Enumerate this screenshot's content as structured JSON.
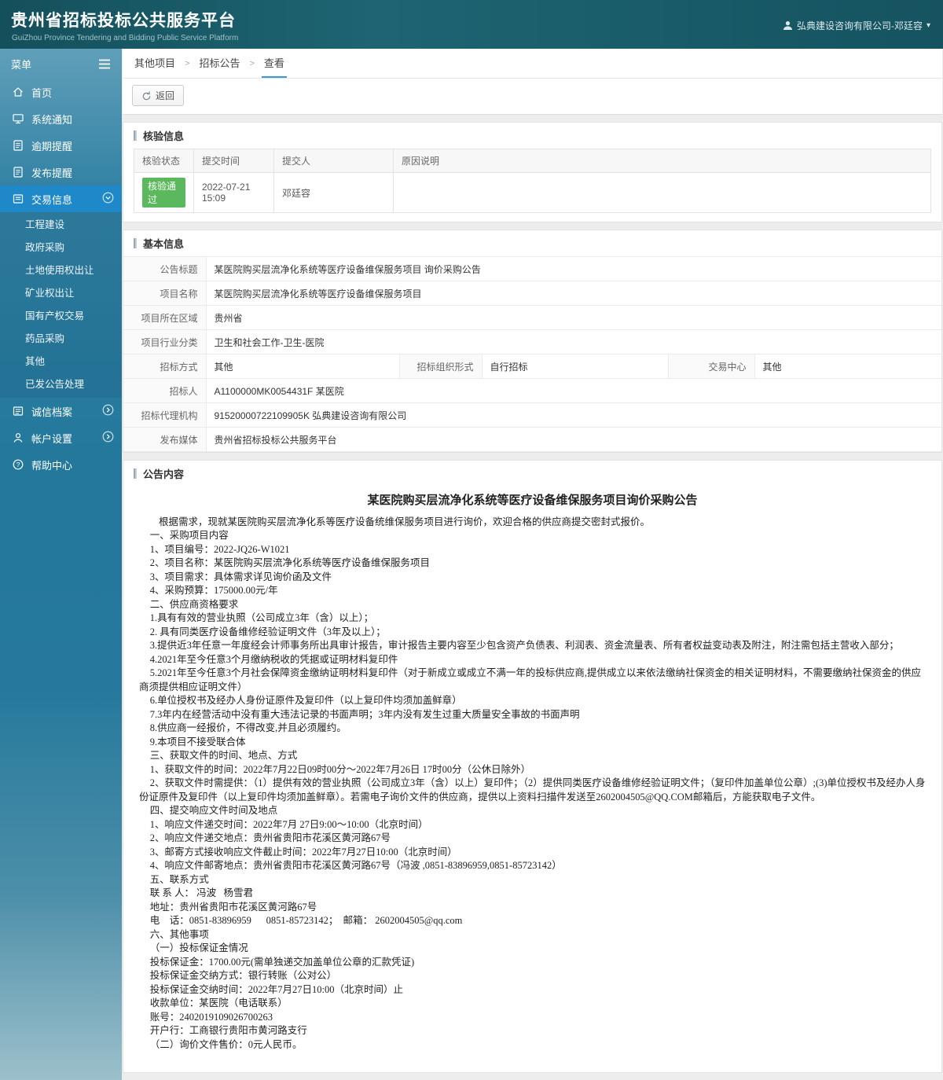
{
  "header": {
    "title": "贵州省招标投标公共服务平台",
    "subtitle": "GuiZhou Province Tendering and Bidding Public Service Platform",
    "user": "弘典建设咨询有限公司-邓廷容"
  },
  "colors": {
    "header_bg": "#1b5662",
    "sidebar_active": "#1e88c8",
    "badge_success": "#5cb85c",
    "tab_active_underline": "#3a9bd0"
  },
  "sidebar": {
    "menu_label": "菜单",
    "items": [
      {
        "label": "首页"
      },
      {
        "label": "系统通知"
      },
      {
        "label": "逾期提醒"
      },
      {
        "label": "发布提醒"
      },
      {
        "label": "交易信息"
      },
      {
        "label": "诚信档案"
      },
      {
        "label": "帐户设置"
      },
      {
        "label": "帮助中心"
      }
    ],
    "submenu": [
      "工程建设",
      "政府采购",
      "土地使用权出让",
      "矿业权出让",
      "国有产权交易",
      "药品采购",
      "其他",
      "已发公告处理"
    ]
  },
  "breadcrumb": [
    "其他项目",
    "招标公告",
    "查看"
  ],
  "toolbar": {
    "back_label": "返回"
  },
  "verify_section": {
    "title": "核验信息",
    "headers": [
      "核验状态",
      "提交时间",
      "提交人",
      "原因说明"
    ],
    "row": {
      "status": "核验通过",
      "submit_time": "2022-07-21 15:09",
      "submitter": "邓廷容",
      "reason": ""
    }
  },
  "basic_section": {
    "title": "基本信息",
    "rows": [
      {
        "label": "公告标题",
        "value": "某医院购买层流净化系统等医疗设备维保服务项目 询价采购公告"
      },
      {
        "label": "项目名称",
        "value": "某医院购买层流净化系统等医疗设备维保服务项目"
      },
      {
        "label": "项目所在区域",
        "value": "贵州省"
      },
      {
        "label": "项目行业分类",
        "value": "卫生和社会工作-卫生-医院"
      }
    ],
    "triple_row": {
      "c1_label": "招标方式",
      "c1_value": "其他",
      "c2_label": "招标组织形式",
      "c2_value": "自行招标",
      "c3_label": "交易中心",
      "c3_value": "其他"
    },
    "rows2": [
      {
        "label": "招标人",
        "value": "A1100000MK0054431F 某医院"
      },
      {
        "label": "招标代理机构",
        "value": "91520000722109905K 弘典建设咨询有限公司"
      },
      {
        "label": "发布媒体",
        "value": "贵州省招标投标公共服务平台"
      }
    ]
  },
  "content_section": {
    "title": "公告内容",
    "doc_title": "某医院购买层流净化系统等医疗设备维保服务项目询价采购公告",
    "intro": "根据需求，现就某医院购买层流净化系等医疗设备统维保服务项目进行询价，欢迎合格的供应商提交密封式报价。",
    "paragraphs": [
      "一、采购项目内容",
      "1、项目编号：2022-JQ26-W1021",
      "2、项目名称：某医院购买层流净化系统等医疗设备维保服务项目",
      "3、项目需求：具体需求详见询价函及文件",
      "4、采购预算：175000.00元/年",
      "二、供应商资格要求",
      "1.具有有效的营业执照（公司成立3年（含）以上）；",
      "2. 具有同类医疗设备维修经验证明文件（3年及以上）；",
      "3.提供近3年任意一年度经会计师事务所出具审计报告，审计报告主要内容至少包含资产负债表、利润表、资金流量表、所有者权益变动表及附注，附注需包括主营收入部分；",
      "4.2021年至今任意3个月缴纳税收的凭据或证明材料复印件",
      "5.2021年至今任意3个月社会保障资金缴纳证明材料复印件（对于新成立或成立不满一年的投标供应商,提供成立以来依法缴纳社保资金的相关证明材料，不需要缴纳社保资金的供应商须提供相应证明文件）",
      "6.单位授权书及经办人身份证原件及复印件（以上复印件均须加盖鲜章）",
      "7.3年内在经营活动中没有重大违法记录的书面声明；3年内没有发生过重大质量安全事故的书面声明",
      "8.供应商一经报价，不得改变,并且必须履约。",
      "9.本项目不接受联合体",
      "三、获取文件的时间、地点、方式",
      "1、获取文件的时间：2022年7月22日09时00分～2022年7月26日 17时00分（公休日除外）",
      "2、获取文件时需提供：（1）提供有效的营业执照（公司成立3年（含）以上）复印件；（2）提供同类医疗设备维修经验证明文件；（复印件加盖单位公章）;(3)单位授权书及经办人身份证原件及复印件（以上复印件均须加盖鲜章）。若需电子询价文件的供应商，提供以上资料扫描件发送至2602004505@QQ.COM邮箱后，方能获取电子文件。",
      "四、提交响应文件时间及地点",
      "1、响应文件递交时间：2022年7月 27日9:00～10:00（北京时间）",
      "2、响应文件递交地点：贵州省贵阳市花溪区黄河路67号",
      "3、邮寄方式接收响应文件截止时间：2022年7月27日10:00（北京时间）",
      "4、响应文件邮寄地点：贵州省贵阳市花溪区黄河路67号（冯波 ,0851-83896959,0851-85723142）",
      "五、联系方式",
      "联 系 人： 冯波   杨雪君",
      "地址：贵州省贵阳市花溪区黄河路67号",
      "电    话：0851-83896959      0851-85723142；  邮箱： 2602004505@qq.com",
      "六、其他事项",
      "（一）投标保证金情况",
      "投标保证金：1700.00元(需单独递交加盖单位公章的汇款凭证)",
      "投标保证金交纳方式：银行转账（公对公）",
      "投标保证金交纳时间：2022年7月27日10:00（北京时间）止",
      "收款单位：某医院（电话联系）",
      "账号：2402019109026700263",
      "开户行：工商银行贵阳市黄河路支行",
      "（二）询价文件售价：0元人民币。"
    ]
  }
}
